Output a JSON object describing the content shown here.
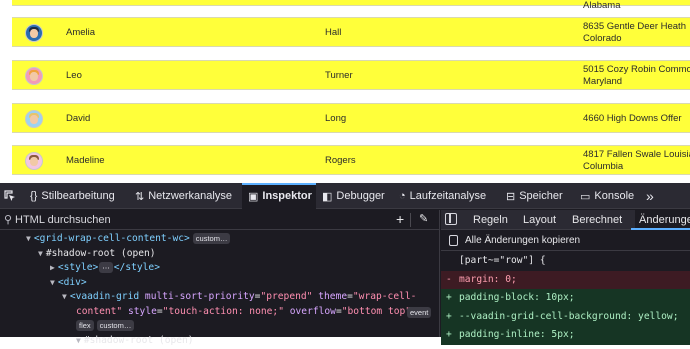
{
  "grid": {
    "rows": [
      {
        "first": "Amelia",
        "last": "Hall",
        "address_line1": "8635 Gentle Deer Heath",
        "address_line2": "Colorado",
        "avatar_color": "#2b6cb0",
        "hair_color": "#1f2a44"
      },
      {
        "first": "Leo",
        "last": "Turner",
        "address_line1": "5015 Cozy Robin Commo",
        "address_line2": "Maryland",
        "avatar_color": "#f29bb8",
        "hair_color": "#f0a33c"
      },
      {
        "first": "David",
        "last": "Long",
        "address_line1": "4660 High Downs Offer",
        "address_line2": "",
        "avatar_color": "#9bd3f2",
        "hair_color": "#e8c46a"
      },
      {
        "first": "Madeline",
        "last": "Rogers",
        "address_line1": "4817 Fallen Swale Louisia",
        "address_line2": "Columbia",
        "avatar_color": "#f3c6e3",
        "hair_color": "#8a5a3c"
      }
    ],
    "partial_top_text": "Alabama"
  },
  "devtools": {
    "tabs": [
      {
        "icon": "cursor-icon",
        "label": ""
      },
      {
        "icon": "braces-icon",
        "label": "Stilbearbeitung"
      },
      {
        "icon": "arrows-icon",
        "label": "Netzwerkanalyse"
      },
      {
        "icon": "inspector-icon",
        "label": "Inspektor"
      },
      {
        "icon": "debugger-icon",
        "label": "Debugger"
      },
      {
        "icon": "gauge-icon",
        "label": "Laufzeitanalyse"
      },
      {
        "icon": "storage-icon",
        "label": "Speicher"
      },
      {
        "icon": "console-icon",
        "label": "Konsole"
      },
      {
        "icon": "overflow-icon",
        "label": "»"
      }
    ],
    "active_tab": "Inspektor",
    "search_placeholder": "HTML durchsuchen",
    "tree": {
      "l1_tag": "<grid-wrap-cell-content-wc>",
      "l1_badge": "custom…",
      "l2": "#shadow-root (open)",
      "l3_open": "<style>",
      "l3_badge": "⋯",
      "l3_close": "</style>",
      "l4": "<div>",
      "l5_tag": "<vaadin-grid",
      "l5_attr1": "multi-sort-priority",
      "l5_val1": "\"prepend\"",
      "l5_attr2": "theme",
      "l5_val2": "\"wrap-cell-",
      "l6_val2b": "content\"",
      "l6_attr3": "style",
      "l6_val3": "\"touch-action: none;\"",
      "l6_attr4": "overflow",
      "l6_val4": "\"bottom top\"",
      "l6_close": ">",
      "l5_badge": "event",
      "l7_badge1": "flex",
      "l7_badge2": "custom…",
      "l8": "#shadow-root (open)"
    },
    "rules_tabs": [
      "Regeln",
      "Layout",
      "Berechnet",
      "Änderunge"
    ],
    "active_rules_tab": "Änderunge",
    "copy_all_label": "Alle Änderungen kopieren",
    "diff": [
      {
        "type": "plain",
        "marker": "",
        "text": "[part~=\"row\"] {"
      },
      {
        "type": "rem",
        "marker": "-",
        "text": "margin: 0;"
      },
      {
        "type": "add",
        "marker": "+",
        "text": "padding-block: 10px;"
      },
      {
        "type": "add",
        "marker": "+",
        "text": "--vaadin-grid-cell-background: yellow;"
      },
      {
        "type": "add",
        "marker": "+",
        "text": "padding-inline: 5px;"
      }
    ]
  }
}
